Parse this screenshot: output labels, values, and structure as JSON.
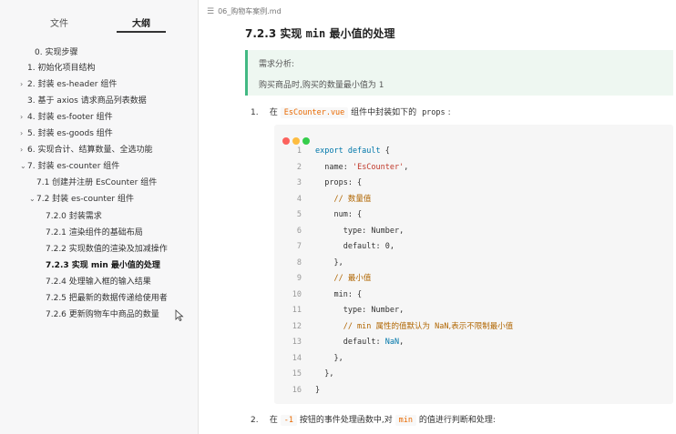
{
  "sidebar": {
    "tab_file": "文件",
    "tab_outline": "大纲",
    "items": [
      {
        "caret": "",
        "label": "0. 实现步骤"
      },
      {
        "caret": "",
        "label": "1. 初始化项目结构"
      },
      {
        "caret": "›",
        "label": "2. 封装 es-header 组件"
      },
      {
        "caret": "",
        "label": "3. 基于 axios 请求商品列表数据"
      },
      {
        "caret": "›",
        "label": "4. 封装 es-footer 组件"
      },
      {
        "caret": "›",
        "label": "5. 封装 es-goods 组件"
      },
      {
        "caret": "›",
        "label": "6. 实现合计、结算数量、全选功能"
      },
      {
        "caret": "⌄",
        "label": "7. 封装 es-counter 组件"
      },
      {
        "caret": "",
        "label": "7.1 创建并注册 EsCounter 组件"
      },
      {
        "caret": "⌄",
        "label": "7.2 封装 es-counter 组件"
      },
      {
        "caret": "",
        "label": "7.2.0 封装需求"
      },
      {
        "caret": "",
        "label": "7.2.1 渲染组件的基础布局"
      },
      {
        "caret": "",
        "label": "7.2.2 实现数值的渲染及加减操作"
      },
      {
        "caret": "",
        "label": "7.2.3 实现 min 最小值的处理"
      },
      {
        "caret": "",
        "label": "7.2.4 处理输入框的输入结果"
      },
      {
        "caret": "",
        "label": "7.2.5 把最新的数据传递给使用者"
      },
      {
        "caret": "",
        "label": "7.2.6 更新购物车中商品的数量"
      }
    ]
  },
  "main": {
    "filename": "06_购物车案例.md",
    "heading_num": "7.2.3",
    "heading_text1": "实现",
    "heading_code": "min",
    "heading_text2": "最小值的处理",
    "quote_title": "需求分析:",
    "quote_body": "购买商品时,购买的数量最小值为",
    "quote_value": "1",
    "step1_num": "1.",
    "step1_pre": "在",
    "step1_code": "EsCounter.vue",
    "step1_mid": "组件中封装如下的",
    "step1_code2": "props",
    "step1_post": ":",
    "step2_num": "2.",
    "step2_pre": "在",
    "step2_code": "-1",
    "step2_mid": "按钮的事件处理函数中,对",
    "step2_code2": "min",
    "step2_post": "的值进行判断和处理:",
    "code": [
      {
        "n": "1"
      },
      {
        "n": "2"
      },
      {
        "n": "3"
      },
      {
        "n": "4"
      },
      {
        "n": "5"
      },
      {
        "n": "6"
      },
      {
        "n": "7"
      },
      {
        "n": "8"
      },
      {
        "n": "9"
      },
      {
        "n": "10"
      },
      {
        "n": "11"
      },
      {
        "n": "12"
      },
      {
        "n": "13"
      },
      {
        "n": "14"
      },
      {
        "n": "15"
      },
      {
        "n": "16"
      }
    ],
    "code_text": {
      "l1a": "export default",
      "l1b": " {",
      "l2a": "  name: ",
      "l2b": "'EsCounter'",
      "l2c": ",",
      "l3": "  props: {",
      "l4a": "    // ",
      "l4b": "数量值",
      "l5": "    num: {",
      "l6": "      type: Number,",
      "l7": "      default: 0,",
      "l8": "    },",
      "l9a": "    // ",
      "l9b": "最小值",
      "l10": "    min: {",
      "l11": "      type: Number,",
      "l12a": "      // min ",
      "l12b": "属性的值默认为",
      "l12c": " NaN",
      "l12d": ",表示不限制最小值",
      "l13a": "      default: ",
      "l13b": "NaN",
      "l13c": ",",
      "l14": "    },",
      "l15": "  },",
      "l16": "}"
    }
  },
  "colors": {
    "accent": "#42b983",
    "inline_code": "#e96900",
    "keyword": "#0077aa",
    "string": "#c0392b",
    "comment": "#b06500"
  }
}
